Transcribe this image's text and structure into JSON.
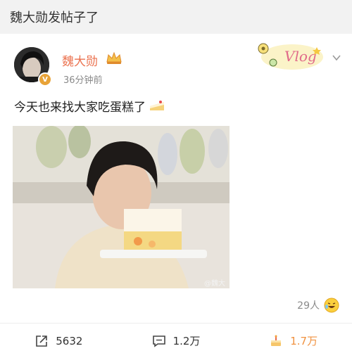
{
  "header": {
    "title": "魏大勋发帖子了"
  },
  "post": {
    "username": "魏大勋",
    "time": "36分钟前",
    "text": "今天也来找大家吃蛋糕了",
    "sticker_text": "Vlog",
    "watermark": "@魏大",
    "reaction_count": "29人"
  },
  "actions": {
    "repost": "5632",
    "comment": "1.2万",
    "like": "1.7万"
  },
  "colors": {
    "username": "#eb7350",
    "like_active": "#f09240",
    "muted_text": "#8a8a8a"
  }
}
